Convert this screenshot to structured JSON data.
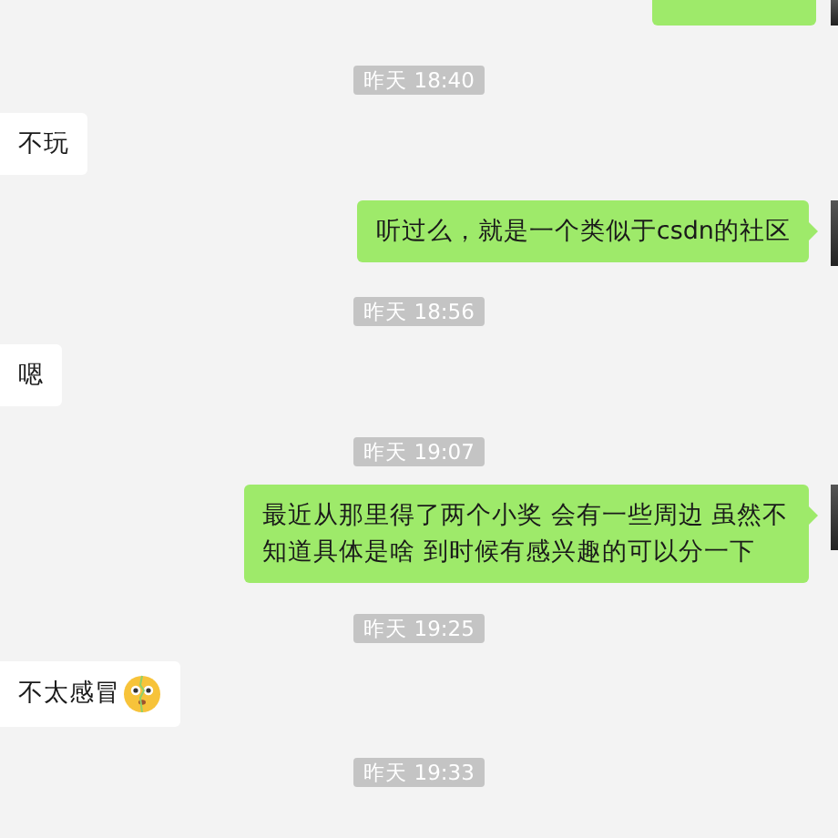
{
  "messages": [
    {
      "kind": "cut_message",
      "outgoing": true
    },
    {
      "kind": "time",
      "text": "昨天 18:40"
    },
    {
      "kind": "message",
      "outgoing": false,
      "text": "不玩"
    },
    {
      "kind": "message",
      "outgoing": true,
      "text": "听过么，就是一个类似于csdn的社区"
    },
    {
      "kind": "time",
      "text": "昨天 18:56"
    },
    {
      "kind": "message",
      "outgoing": false,
      "text": "嗯"
    },
    {
      "kind": "time",
      "text": "昨天 19:07"
    },
    {
      "kind": "message",
      "outgoing": true,
      "text": "最近从那里得了两个小奖 会有一些周边 虽然不知道具体是啥 到时候有感兴趣的可以分一下"
    },
    {
      "kind": "time",
      "text": "昨天 19:25"
    },
    {
      "kind": "message",
      "outgoing": false,
      "text": "不太感冒",
      "emoji": true
    },
    {
      "kind": "time",
      "text": "昨天 19:33"
    }
  ]
}
